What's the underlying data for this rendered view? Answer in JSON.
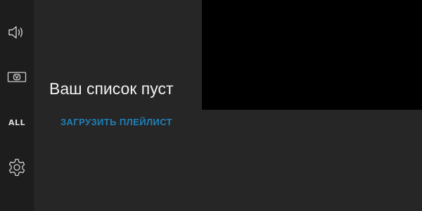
{
  "sidebar": {
    "items": [
      {
        "icon": "volume-icon"
      },
      {
        "icon": "tv-icon"
      },
      {
        "label": "ALL"
      },
      {
        "icon": "settings-icon"
      }
    ]
  },
  "main": {
    "empty_title": "Ваш список пуст",
    "load_playlist_label": "ЗАГРУЗИТЬ ПЛЕЙЛИСТ"
  },
  "colors": {
    "background": "#262626",
    "sidebar": "#1d1d1d",
    "video": "#000000",
    "accent": "#1f80b8",
    "text": "#f2f2f2"
  }
}
